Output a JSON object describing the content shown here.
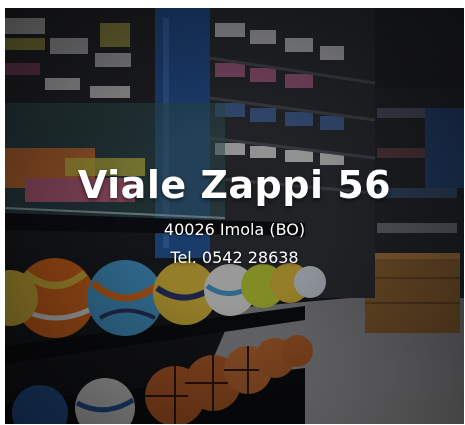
{
  "store": {
    "street": "Viale Zappi 56",
    "city_line": "40026 Imola (BO)",
    "phone_line": "Tel. 0542 28638"
  },
  "colors": {
    "overlay_text": "#ffffff",
    "ball_orange": "#e8711f",
    "ball_blue": "#4aa3d8",
    "ball_yellow": "#e8c640",
    "shelf_blue": "#2a5ea8"
  }
}
